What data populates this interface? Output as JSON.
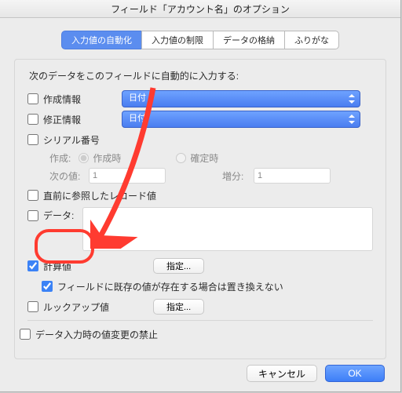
{
  "window": {
    "title": "フィールド「アカウント名」のオプション"
  },
  "tabs": [
    {
      "label": "入力値の自動化",
      "active": true
    },
    {
      "label": "入力値の制限"
    },
    {
      "label": "データの格納"
    },
    {
      "label": "ふりがな"
    }
  ],
  "section": {
    "heading": "次のデータをこのフィールドに自動的に入力する:",
    "create_info": {
      "label": "作成情報",
      "checked": false,
      "select": "日付"
    },
    "modify_info": {
      "label": "修正情報",
      "checked": false,
      "select": "日付"
    },
    "serial": {
      "label": "シリアル番号",
      "checked": false,
      "create_label": "作成:",
      "on_create": "作成時",
      "on_commit": "確定時",
      "selected": "on_create",
      "next_label": "次の値:",
      "next_value": "1",
      "inc_label": "増分:",
      "inc_value": "1"
    },
    "last_visited": {
      "label": "直前に参照したレコード値",
      "checked": false
    },
    "data_value": {
      "label": "データ:",
      "checked": false,
      "value": ""
    },
    "calc": {
      "label": "計算値",
      "checked": true,
      "button": "指定...",
      "replace_label": "フィールドに既存の値が存在する場合は置き換えない",
      "replace_checked": true
    },
    "lookup": {
      "label": "ルックアップ値",
      "checked": false,
      "button": "指定..."
    }
  },
  "prohibit": {
    "label": "データ入力時の値変更の禁止",
    "checked": false
  },
  "footer": {
    "cancel": "キャンセル",
    "ok": "OK"
  }
}
